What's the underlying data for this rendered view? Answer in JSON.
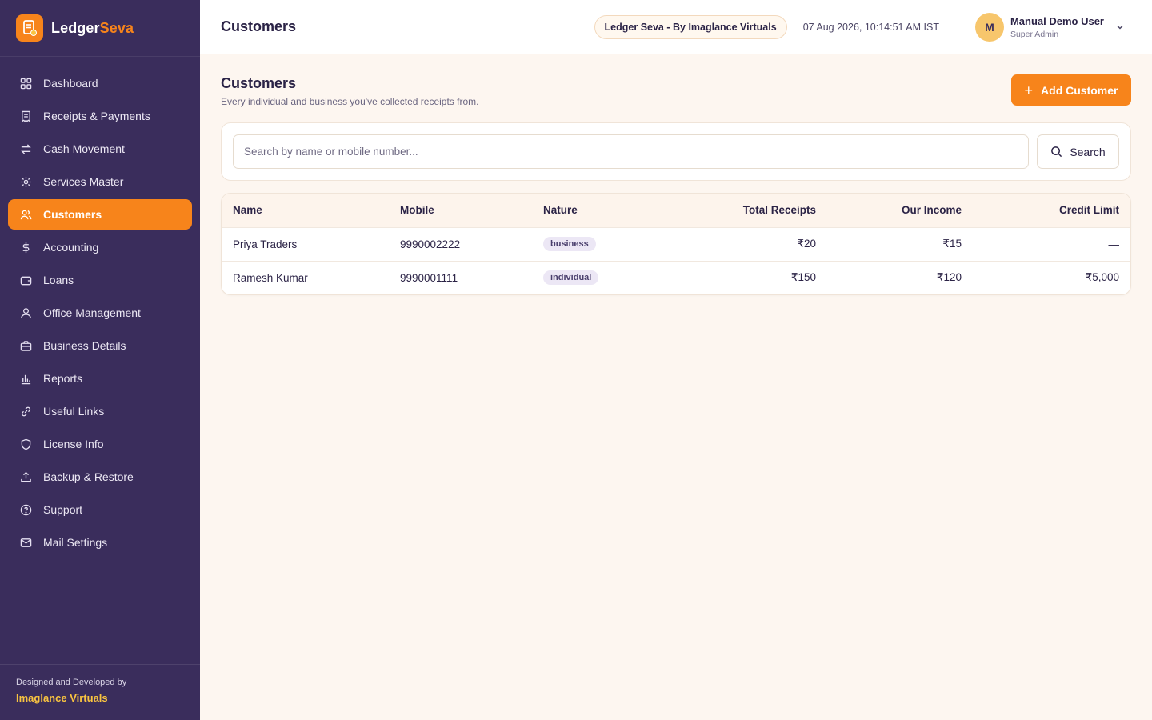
{
  "brand": {
    "name_part1": "Ledger",
    "name_part2": "Seva"
  },
  "sidebar": {
    "items": [
      {
        "label": "Dashboard",
        "icon": "grid-icon",
        "active": false
      },
      {
        "label": "Receipts & Payments",
        "icon": "receipt-icon",
        "active": false
      },
      {
        "label": "Cash Movement",
        "icon": "transfer-icon",
        "active": false
      },
      {
        "label": "Services Master",
        "icon": "gear-icon",
        "active": false
      },
      {
        "label": "Customers",
        "icon": "users-icon",
        "active": true
      },
      {
        "label": "Accounting",
        "icon": "dollar-icon",
        "active": false
      },
      {
        "label": "Loans",
        "icon": "wallet-icon",
        "active": false
      },
      {
        "label": "Office Management",
        "icon": "user-icon",
        "active": false
      },
      {
        "label": "Business Details",
        "icon": "briefcase-icon",
        "active": false
      },
      {
        "label": "Reports",
        "icon": "bar-chart-icon",
        "active": false
      },
      {
        "label": "Useful Links",
        "icon": "link-icon",
        "active": false
      },
      {
        "label": "License Info",
        "icon": "shield-icon",
        "active": false
      },
      {
        "label": "Backup & Restore",
        "icon": "upload-icon",
        "active": false
      },
      {
        "label": "Support",
        "icon": "help-circle-icon",
        "active": false
      },
      {
        "label": "Mail Settings",
        "icon": "mail-icon",
        "active": false
      }
    ],
    "footer": {
      "credit_line": "Designed and Developed by",
      "credit_name": "Imaglance Virtuals"
    }
  },
  "header": {
    "title": "Customers",
    "org_pill": "Ledger Seva - By Imaglance Virtuals",
    "datetime": "07 Aug 2026, 10:14:51 AM IST",
    "user": {
      "initial": "M",
      "name": "Manual Demo User",
      "role": "Super Admin"
    }
  },
  "page": {
    "title": "Customers",
    "subtitle": "Every individual and business you've collected receipts from.",
    "add_button": "Add Customer"
  },
  "search": {
    "placeholder": "Search by name or mobile number...",
    "value": "",
    "button_label": "Search"
  },
  "table": {
    "columns": [
      "Name",
      "Mobile",
      "Nature",
      "Total Receipts",
      "Our Income",
      "Credit Limit"
    ],
    "rows": [
      {
        "name": "Priya Traders",
        "mobile": "9990002222",
        "nature": "business",
        "total_receipts": "₹20",
        "our_income": "₹15",
        "credit_limit": "—"
      },
      {
        "name": "Ramesh Kumar",
        "mobile": "9990001111",
        "nature": "individual",
        "total_receipts": "₹150",
        "our_income": "₹120",
        "credit_limit": "₹5,000"
      }
    ]
  },
  "colors": {
    "sidebar_bg": "#3a2d5c",
    "accent": "#f7841b",
    "page_bg": "#fdf6f0",
    "credit_highlight": "#f9c440"
  }
}
